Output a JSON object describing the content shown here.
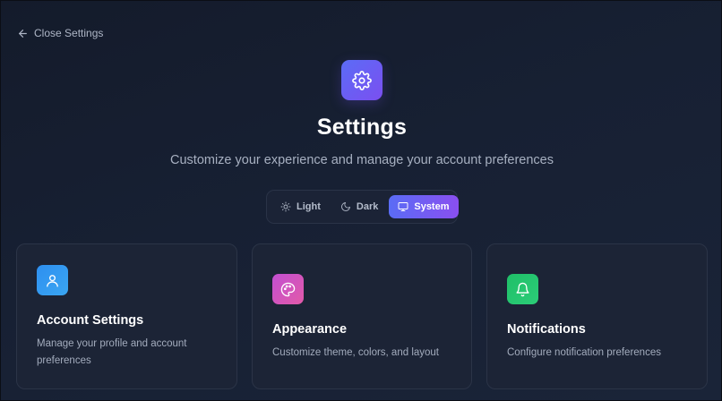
{
  "nav": {
    "back_label": "Close Settings"
  },
  "header": {
    "title": "Settings",
    "subtitle": "Customize your experience and manage your account preferences"
  },
  "theme_switch": {
    "options": [
      {
        "label": "Light",
        "icon": "sun-icon"
      },
      {
        "label": "Dark",
        "icon": "moon-icon"
      },
      {
        "label": "System",
        "icon": "monitor-icon"
      }
    ],
    "selected": "System"
  },
  "cards": [
    {
      "title": "Account Settings",
      "description": "Manage your profile and account preferences",
      "icon": "user-icon",
      "color": "#2f8ff0"
    },
    {
      "title": "Appearance",
      "description": "Customize theme, colors, and layout",
      "icon": "palette-icon",
      "color": "#d04fc8"
    },
    {
      "title": "Notifications",
      "description": "Configure notification preferences",
      "icon": "bell-icon",
      "color": "#1fc06a"
    }
  ],
  "colors": {
    "accent_start": "#5b6cf6",
    "accent_end": "#8a4ff0",
    "background": "#172033",
    "card_background": "#1c2436"
  }
}
